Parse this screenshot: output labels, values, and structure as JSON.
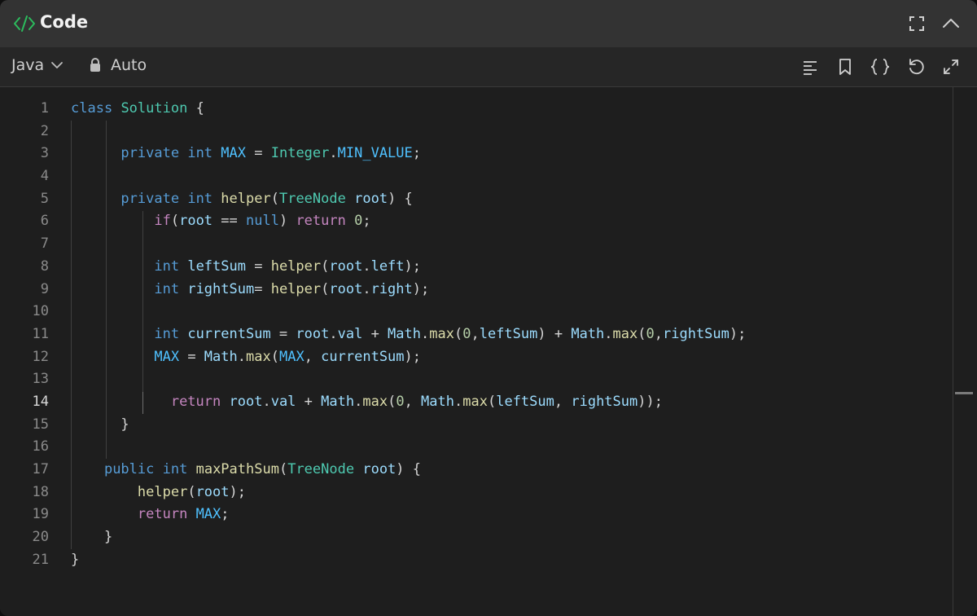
{
  "header": {
    "title": "Code"
  },
  "toolbar": {
    "language": "Java",
    "mode": "Auto"
  },
  "editor": {
    "active_line": 14,
    "line_numbers": [
      "1",
      "2",
      "3",
      "4",
      "5",
      "6",
      "7",
      "8",
      "9",
      "10",
      "11",
      "12",
      "13",
      "14",
      "15",
      "16",
      "17",
      "18",
      "19",
      "20",
      "21"
    ],
    "lines": [
      [
        {
          "t": "class",
          "c": "k"
        },
        {
          "t": " ",
          "c": "p"
        },
        {
          "t": "Solution",
          "c": "t"
        },
        {
          "t": " {",
          "c": "p"
        }
      ],
      [],
      [
        {
          "t": "      ",
          "c": "p"
        },
        {
          "t": "private",
          "c": "k"
        },
        {
          "t": " ",
          "c": "p"
        },
        {
          "t": "int",
          "c": "k"
        },
        {
          "t": " ",
          "c": "p"
        },
        {
          "t": "MAX",
          "c": "c"
        },
        {
          "t": " = ",
          "c": "p"
        },
        {
          "t": "Integer",
          "c": "t"
        },
        {
          "t": ".",
          "c": "p"
        },
        {
          "t": "MIN_VALUE",
          "c": "c"
        },
        {
          "t": ";",
          "c": "p"
        }
      ],
      [],
      [
        {
          "t": "      ",
          "c": "p"
        },
        {
          "t": "private",
          "c": "k"
        },
        {
          "t": " ",
          "c": "p"
        },
        {
          "t": "int",
          "c": "k"
        },
        {
          "t": " ",
          "c": "p"
        },
        {
          "t": "helper",
          "c": "f"
        },
        {
          "t": "(",
          "c": "p"
        },
        {
          "t": "TreeNode",
          "c": "t"
        },
        {
          "t": " ",
          "c": "p"
        },
        {
          "t": "root",
          "c": "v"
        },
        {
          "t": ") {",
          "c": "p"
        }
      ],
      [
        {
          "t": "          ",
          "c": "p"
        },
        {
          "t": "if",
          "c": "ctrl"
        },
        {
          "t": "(",
          "c": "p"
        },
        {
          "t": "root",
          "c": "v"
        },
        {
          "t": " == ",
          "c": "p"
        },
        {
          "t": "null",
          "c": "k"
        },
        {
          "t": ") ",
          "c": "p"
        },
        {
          "t": "return",
          "c": "ctrl"
        },
        {
          "t": " ",
          "c": "p"
        },
        {
          "t": "0",
          "c": "n"
        },
        {
          "t": ";",
          "c": "p"
        }
      ],
      [],
      [
        {
          "t": "          ",
          "c": "p"
        },
        {
          "t": "int",
          "c": "k"
        },
        {
          "t": " ",
          "c": "p"
        },
        {
          "t": "leftSum",
          "c": "v"
        },
        {
          "t": " = ",
          "c": "p"
        },
        {
          "t": "helper",
          "c": "f"
        },
        {
          "t": "(",
          "c": "p"
        },
        {
          "t": "root",
          "c": "v"
        },
        {
          "t": ".",
          "c": "p"
        },
        {
          "t": "left",
          "c": "v"
        },
        {
          "t": ");",
          "c": "p"
        }
      ],
      [
        {
          "t": "          ",
          "c": "p"
        },
        {
          "t": "int",
          "c": "k"
        },
        {
          "t": " ",
          "c": "p"
        },
        {
          "t": "rightSum",
          "c": "v"
        },
        {
          "t": "= ",
          "c": "p"
        },
        {
          "t": "helper",
          "c": "f"
        },
        {
          "t": "(",
          "c": "p"
        },
        {
          "t": "root",
          "c": "v"
        },
        {
          "t": ".",
          "c": "p"
        },
        {
          "t": "right",
          "c": "v"
        },
        {
          "t": ");",
          "c": "p"
        }
      ],
      [],
      [
        {
          "t": "          ",
          "c": "p"
        },
        {
          "t": "int",
          "c": "k"
        },
        {
          "t": " ",
          "c": "p"
        },
        {
          "t": "currentSum",
          "c": "v"
        },
        {
          "t": " = ",
          "c": "p"
        },
        {
          "t": "root",
          "c": "v"
        },
        {
          "t": ".",
          "c": "p"
        },
        {
          "t": "val",
          "c": "v"
        },
        {
          "t": " + ",
          "c": "p"
        },
        {
          "t": "Math",
          "c": "v"
        },
        {
          "t": ".",
          "c": "p"
        },
        {
          "t": "max",
          "c": "f"
        },
        {
          "t": "(",
          "c": "p"
        },
        {
          "t": "0",
          "c": "n"
        },
        {
          "t": ",",
          "c": "p"
        },
        {
          "t": "leftSum",
          "c": "v"
        },
        {
          "t": ") + ",
          "c": "p"
        },
        {
          "t": "Math",
          "c": "v"
        },
        {
          "t": ".",
          "c": "p"
        },
        {
          "t": "max",
          "c": "f"
        },
        {
          "t": "(",
          "c": "p"
        },
        {
          "t": "0",
          "c": "n"
        },
        {
          "t": ",",
          "c": "p"
        },
        {
          "t": "rightSum",
          "c": "v"
        },
        {
          "t": ");",
          "c": "p"
        }
      ],
      [
        {
          "t": "          ",
          "c": "p"
        },
        {
          "t": "MAX",
          "c": "c"
        },
        {
          "t": " = ",
          "c": "p"
        },
        {
          "t": "Math",
          "c": "v"
        },
        {
          "t": ".",
          "c": "p"
        },
        {
          "t": "max",
          "c": "f"
        },
        {
          "t": "(",
          "c": "p"
        },
        {
          "t": "MAX",
          "c": "c"
        },
        {
          "t": ", ",
          "c": "p"
        },
        {
          "t": "currentSum",
          "c": "v"
        },
        {
          "t": ");",
          "c": "p"
        }
      ],
      [],
      [
        {
          "t": "            ",
          "c": "p"
        },
        {
          "t": "return",
          "c": "ctrl"
        },
        {
          "t": " ",
          "c": "p"
        },
        {
          "t": "root",
          "c": "v"
        },
        {
          "t": ".",
          "c": "p"
        },
        {
          "t": "val",
          "c": "v"
        },
        {
          "t": " + ",
          "c": "p"
        },
        {
          "t": "Math",
          "c": "v"
        },
        {
          "t": ".",
          "c": "p"
        },
        {
          "t": "max",
          "c": "f"
        },
        {
          "t": "(",
          "c": "p"
        },
        {
          "t": "0",
          "c": "n"
        },
        {
          "t": ", ",
          "c": "p"
        },
        {
          "t": "Math",
          "c": "v"
        },
        {
          "t": ".",
          "c": "p"
        },
        {
          "t": "max",
          "c": "f"
        },
        {
          "t": "(",
          "c": "p"
        },
        {
          "t": "leftSum",
          "c": "v"
        },
        {
          "t": ", ",
          "c": "p"
        },
        {
          "t": "rightSum",
          "c": "v"
        },
        {
          "t": "));",
          "c": "p"
        }
      ],
      [
        {
          "t": "      }",
          "c": "p"
        }
      ],
      [],
      [
        {
          "t": "    ",
          "c": "p"
        },
        {
          "t": "public",
          "c": "k"
        },
        {
          "t": " ",
          "c": "p"
        },
        {
          "t": "int",
          "c": "k"
        },
        {
          "t": " ",
          "c": "p"
        },
        {
          "t": "maxPathSum",
          "c": "f"
        },
        {
          "t": "(",
          "c": "p"
        },
        {
          "t": "TreeNode",
          "c": "t"
        },
        {
          "t": " ",
          "c": "p"
        },
        {
          "t": "root",
          "c": "v"
        },
        {
          "t": ") {",
          "c": "p"
        }
      ],
      [
        {
          "t": "        ",
          "c": "p"
        },
        {
          "t": "helper",
          "c": "f"
        },
        {
          "t": "(",
          "c": "p"
        },
        {
          "t": "root",
          "c": "v"
        },
        {
          "t": ");",
          "c": "p"
        }
      ],
      [
        {
          "t": "        ",
          "c": "p"
        },
        {
          "t": "return",
          "c": "ctrl"
        },
        {
          "t": " ",
          "c": "p"
        },
        {
          "t": "MAX",
          "c": "c"
        },
        {
          "t": ";",
          "c": "p"
        }
      ],
      [
        {
          "t": "    }",
          "c": "p"
        }
      ],
      [
        {
          "t": "}",
          "c": "p"
        }
      ]
    ]
  },
  "colors": {
    "background": "#1e1e1e",
    "header_bg": "#333333",
    "toolbar_bg": "#262626",
    "code_icon": "#2cbb5d",
    "keyword": "#569cd6",
    "type": "#4ec9b0",
    "function": "#dcdcaa",
    "variable": "#9cdcfe",
    "constant": "#4fc1ff",
    "number": "#b5cea8",
    "control": "#c586c0"
  },
  "icons": {
    "header": [
      "code-icon",
      "fullscreen-icon",
      "chevron-up-icon"
    ],
    "toolbar": [
      "chevron-down-icon",
      "lock-icon",
      "align-left-icon",
      "bookmark-icon",
      "braces-icon",
      "reset-icon",
      "expand-icon"
    ]
  }
}
